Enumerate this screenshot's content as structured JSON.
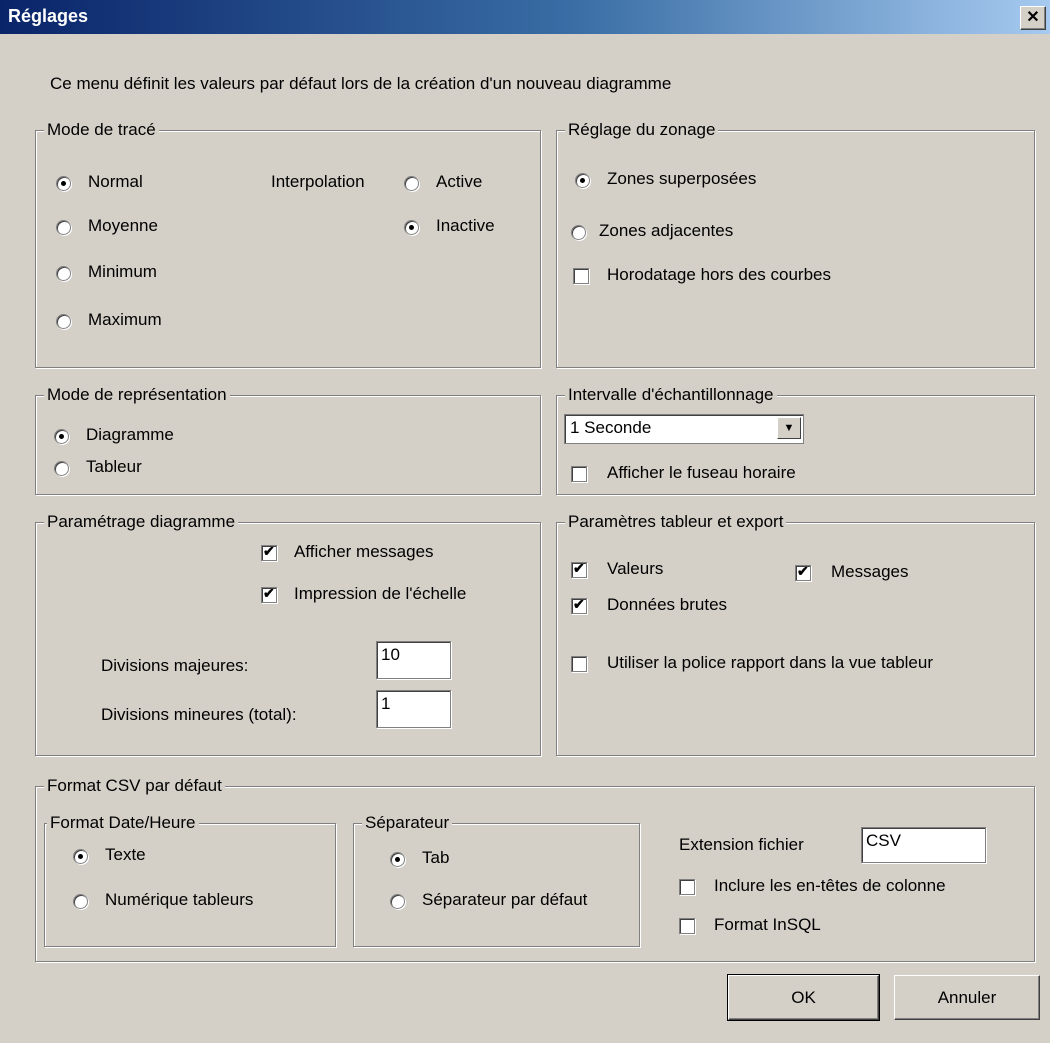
{
  "title": "Réglages",
  "description": "Ce menu définit les valeurs par défaut lors de la création d'un nouveau diagramme",
  "mode_trace": {
    "legend": "Mode de tracé",
    "options": [
      {
        "label": "Normal",
        "selected": true
      },
      {
        "label": "Moyenne",
        "selected": false
      },
      {
        "label": "Minimum",
        "selected": false
      },
      {
        "label": "Maximum",
        "selected": false
      }
    ],
    "interpolation_label": "Interpolation",
    "interpolation_options": [
      {
        "label": "Active",
        "selected": false
      },
      {
        "label": "Inactive",
        "selected": true
      }
    ]
  },
  "zonage": {
    "legend": "Réglage du zonage",
    "options": [
      {
        "label": "Zones superposées",
        "selected": true
      },
      {
        "label": "Zones adjacentes",
        "selected": false
      }
    ],
    "horodatage": {
      "label": "Horodatage hors des courbes",
      "checked": false
    }
  },
  "representation": {
    "legend": "Mode de représentation",
    "options": [
      {
        "label": "Diagramme",
        "selected": true
      },
      {
        "label": "Tableur",
        "selected": false
      }
    ]
  },
  "echantillonnage": {
    "legend": "Intervalle d'échantillonnage",
    "value": "1 Seconde",
    "fuseau": {
      "label": "Afficher le fuseau horaire",
      "checked": false
    }
  },
  "parametrage": {
    "legend": "Paramétrage diagramme",
    "messages": {
      "label": "Afficher messages",
      "checked": true
    },
    "echelle": {
      "label": "Impression de l'échelle",
      "checked": true
    },
    "majeures_label": "Divisions majeures:",
    "majeures_value": "10",
    "mineures_label": "Divisions mineures (total):",
    "mineures_value": "1"
  },
  "tableur_export": {
    "legend": "Paramètres tableur et export",
    "valeurs": {
      "label": "Valeurs",
      "checked": true
    },
    "messages": {
      "label": "Messages",
      "checked": true
    },
    "brutes": {
      "label": "Données brutes",
      "checked": true
    },
    "police": {
      "label": "Utiliser la police rapport dans la vue tableur",
      "checked": false
    }
  },
  "csv": {
    "legend": "Format CSV par défaut",
    "date_format": {
      "legend": "Format Date/Heure",
      "options": [
        {
          "label": "Texte",
          "selected": true
        },
        {
          "label": "Numérique tableurs",
          "selected": false
        }
      ]
    },
    "separateur": {
      "legend": "Séparateur",
      "options": [
        {
          "label": "Tab",
          "selected": true
        },
        {
          "label": "Séparateur par défaut",
          "selected": false
        }
      ]
    },
    "extension_label": "Extension fichier",
    "extension_value": "CSV",
    "entetes": {
      "label": "Inclure les en-têtes de colonne",
      "checked": false
    },
    "insql": {
      "label": "Format InSQL",
      "checked": false
    }
  },
  "buttons": {
    "ok": "OK",
    "annuler": "Annuler"
  }
}
